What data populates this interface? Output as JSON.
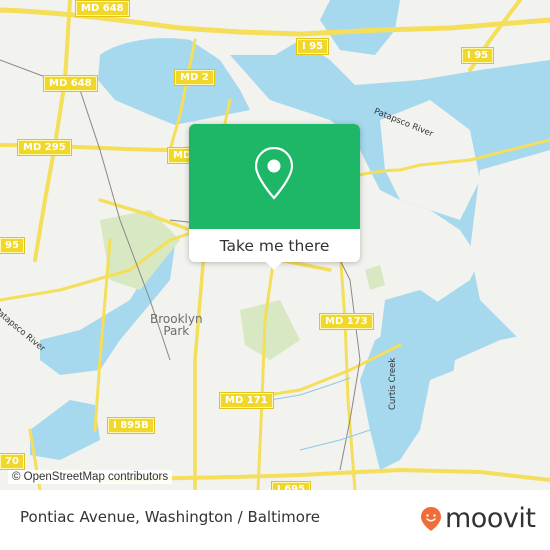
{
  "map": {
    "shields": [
      {
        "id": "md648-top",
        "label": "MD 648"
      },
      {
        "id": "md648-mid",
        "label": "MD 648"
      },
      {
        "id": "md2",
        "label": "MD 2"
      },
      {
        "id": "i95-left",
        "label": "I 95"
      },
      {
        "id": "i95-right",
        "label": "I 95"
      },
      {
        "id": "md295",
        "label": "MD 295"
      },
      {
        "id": "md-partial",
        "label": "MD"
      },
      {
        "id": "i95-west",
        "label": "95"
      },
      {
        "id": "md173",
        "label": "MD 173"
      },
      {
        "id": "md171",
        "label": "MD 171"
      },
      {
        "id": "i895b",
        "label": "I 895B"
      },
      {
        "id": "i70",
        "label": "70"
      },
      {
        "id": "i695",
        "label": "I 695"
      }
    ],
    "places": {
      "brooklyn_park": "Brooklyn\nPark"
    },
    "water_labels": {
      "patapsco_river_east": "Patapsco River",
      "patapsco_river_west": "Patapsco River",
      "curtis_creek": "Curtis Creek"
    },
    "attribution": "© OpenStreetMap contributors",
    "colors": {
      "water": "#a6d8ee",
      "land": "#f2f2ee",
      "road": "#f5de5a",
      "park": "#d8e8c2",
      "shield": "#f0d72a"
    }
  },
  "popup": {
    "icon": "map-pin-icon",
    "button_label": "Take me there",
    "color": "#1db767"
  },
  "footer": {
    "title": "Pontiac Avenue, Washington / Baltimore",
    "brand": "moovit",
    "brand_icon": "moovit-smiley-pin-icon",
    "brand_color": "#f26c3a"
  }
}
